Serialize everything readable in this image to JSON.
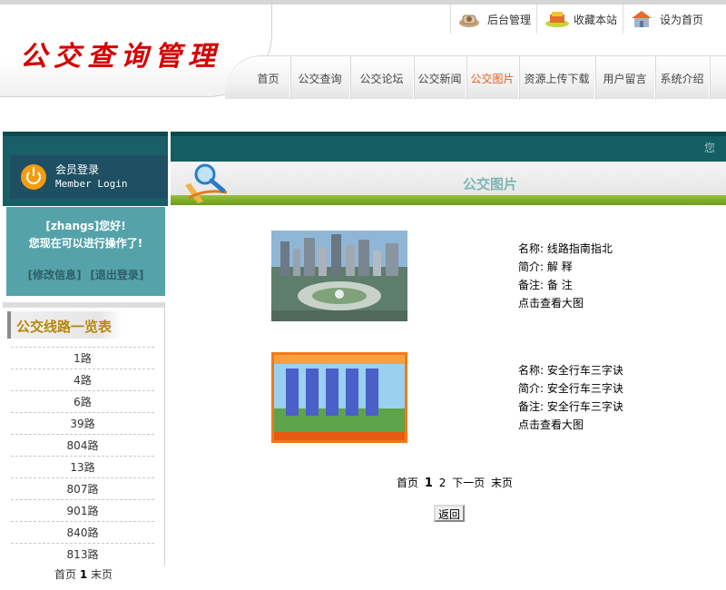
{
  "header": {
    "title": "公交查询管理",
    "top_links": [
      {
        "label": "后台管理",
        "icon": "phone-icon"
      },
      {
        "label": "收藏本站",
        "icon": "favorite-icon"
      },
      {
        "label": "设为首页",
        "icon": "home-icon"
      }
    ],
    "nav": [
      {
        "label": "首页",
        "active": false
      },
      {
        "label": "公交查询",
        "active": false
      },
      {
        "label": "公交论坛",
        "active": false
      },
      {
        "label": "公交新闻",
        "active": false
      },
      {
        "label": "公交图片",
        "active": true
      },
      {
        "label": "资源上传下载",
        "active": false
      },
      {
        "label": "用户留言",
        "active": false
      },
      {
        "label": "系统介绍",
        "active": false
      }
    ]
  },
  "sidebar": {
    "login_title_cn": "会员登录",
    "login_title_en": "Member Login",
    "welcome_user": "[zhangs]您好!",
    "welcome_msg": "您现在可以进行操作了!",
    "edit_link": "[修改信息]",
    "logout_link": "[退出登录]",
    "route_heading": "公交线路一览表",
    "routes": [
      "1路",
      "4路",
      "6路",
      "39路",
      "804路",
      "13路",
      "807路",
      "901路",
      "840路",
      "813路"
    ],
    "pager": {
      "first": "首页",
      "current": "1",
      "last": "末页"
    }
  },
  "main": {
    "banner_text": "您",
    "section_title": "公交图片",
    "pictures": [
      {
        "name_label": "名称:",
        "name": "线路指南指北",
        "intro_label": "简介:",
        "intro": "解 释",
        "note_label": "备注:",
        "note": "备 注",
        "view_link": "点击查看大图"
      },
      {
        "name_label": "名称:",
        "name": "安全行车三字诀",
        "intro_label": "简介:",
        "intro": "安全行车三字诀",
        "note_label": "备注:",
        "note": "安全行车三字诀",
        "view_link": "点击查看大图"
      }
    ],
    "pager": {
      "first": "首页",
      "current": "1",
      "page2": "2",
      "next": "下一页",
      "last": "末页"
    },
    "back_button": "返回"
  },
  "colors": {
    "title_red": "#d40000",
    "nav_active": "#e85a1a",
    "teal_banner": "#135f63",
    "green_bar": "#7aa82a"
  }
}
